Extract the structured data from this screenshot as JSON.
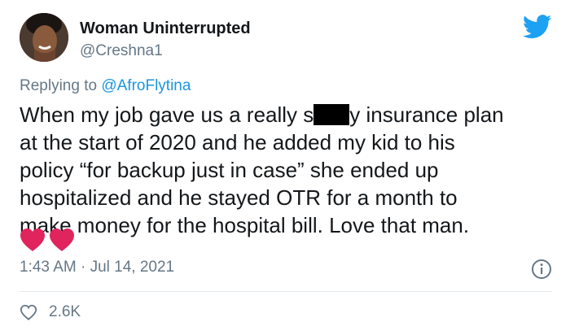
{
  "author": {
    "name": "Woman Uninterrupted",
    "handle": "@Creshna1"
  },
  "reply": {
    "prefix": "Replying to ",
    "to": "@AfroFlytina"
  },
  "body": {
    "line1_a": "When my job gave us a really s",
    "line1_b": "y insurance plan",
    "line2": "at the start of 2020 and he added my kid to his",
    "line3": "policy “for backup just in case” she ended up",
    "line4": "hospitalized and he stayed OTR for a month to",
    "line5": "make money for the hospital bill. Love that man."
  },
  "emoji": [
    "red-heart",
    "red-heart"
  ],
  "meta": {
    "timestamp": "1:43 AM · Jul 14, 2021"
  },
  "stats": {
    "likes": "2.6K"
  },
  "icons": {
    "brand": "twitter-bird-icon",
    "info": "info-icon",
    "like": "heart-outline-icon"
  },
  "colors": {
    "brand": "#1da1f2",
    "link": "#1b95e0",
    "muted": "#657786",
    "heart": "#e0245e"
  }
}
